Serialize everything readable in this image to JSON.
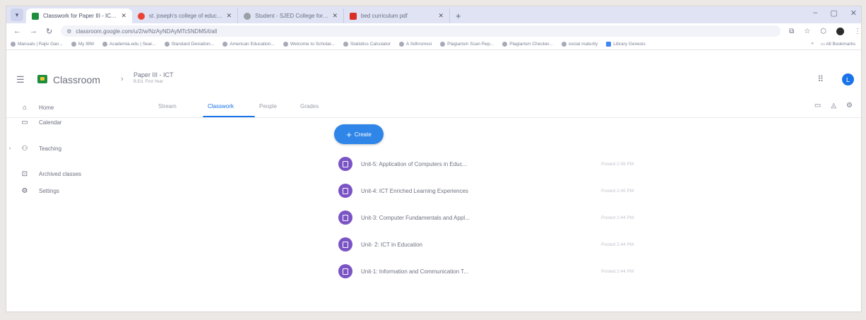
{
  "browser": {
    "tabs": [
      {
        "label": "Classwork for Paper III - ICT Ed...",
        "favicon_color": "#1e8e3e",
        "active": true
      },
      {
        "label": "st. joseph's college of education",
        "favicon_color": "#ea4335",
        "active": false
      },
      {
        "label": "Student - SJED College for Wom...",
        "favicon_color": "#9aa0a6",
        "active": false
      },
      {
        "label": "bed curriculum pdf",
        "favicon_color": "#d93025",
        "active": false
      }
    ],
    "new_tab": "+",
    "window_controls": [
      "–",
      "▢",
      "✕"
    ],
    "url": "classroom.google.com/u/2/w/NzAyNDAyMTc5NDM5/t/all",
    "bookmarks": [
      "Manuals | Rajiv Gan...",
      "My IBM",
      "Academia.edu | Sear...",
      "Standard Deviation...",
      "American Education...",
      "Welcome to Scholar...",
      "Statistics Calculator",
      "A Sdhrsmvsi",
      "Plagiarism Scan Rep...",
      "Plagiarism Checker...",
      "social maturity",
      "Library Genesis"
    ],
    "all_bookmarks": "All Bookmarks"
  },
  "header": {
    "app_title": "Classroom",
    "course_name": "Paper III - ICT",
    "course_section": "B.Ed. First Year",
    "avatar_letter": "L"
  },
  "sidebar": {
    "items": [
      {
        "label": "Home",
        "icon": "home-icon"
      },
      {
        "label": "Calendar",
        "icon": "calendar-icon"
      },
      {
        "label": "Teaching",
        "icon": "people-icon"
      },
      {
        "label": "Archived classes",
        "icon": "archive-icon"
      },
      {
        "label": "Settings",
        "icon": "gear-icon"
      }
    ]
  },
  "tabs": [
    {
      "label": "Stream"
    },
    {
      "label": "Classwork"
    },
    {
      "label": "People"
    },
    {
      "label": "Grades"
    }
  ],
  "create_label": "Create",
  "topics": [
    {
      "title": "Unit-5: Application of Computers in Educ...",
      "posted": "Posted 2:49 PM"
    },
    {
      "title": "Unit-4: ICT Enriched Learning Experiences",
      "posted": "Posted 2:45 PM"
    },
    {
      "title": "Unit-3: Computer Fundamentals and Appl...",
      "posted": "Posted 2:44 PM"
    },
    {
      "title": "Unit- 2: ICT in Education",
      "posted": "Posted 2:44 PM"
    },
    {
      "title": "Unit-1: Information and Communication T...",
      "posted": "Posted 2:44 PM"
    }
  ],
  "colors": {
    "accent": "#1a73e8",
    "topic_icon": "#7a54c4",
    "create_button": "#2f86e8"
  }
}
